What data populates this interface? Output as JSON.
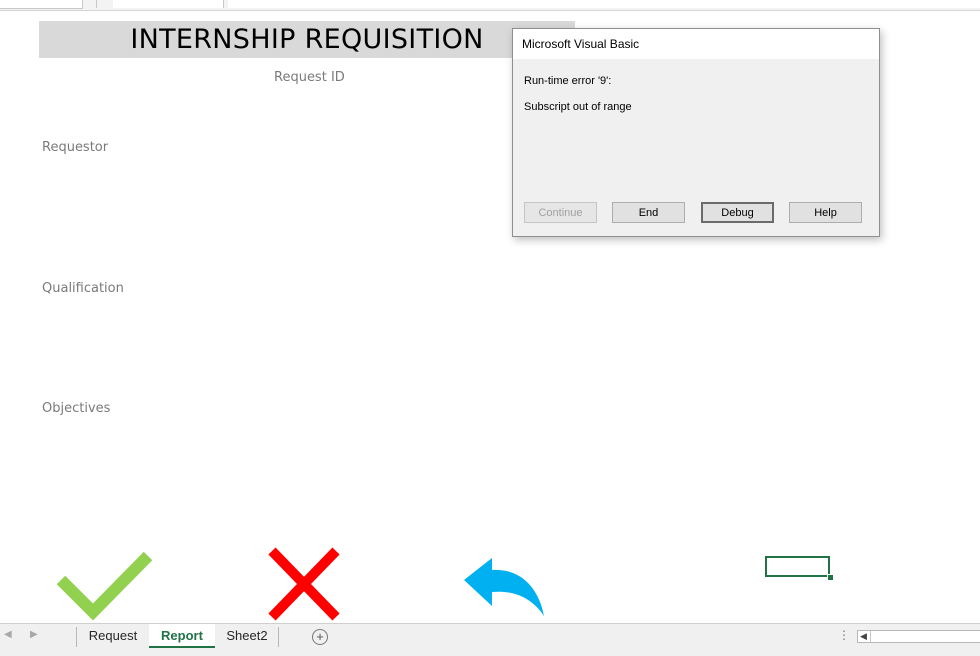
{
  "sheet": {
    "title": "INTERNSHIP REQUISITION",
    "request_id_label": "Request ID",
    "requestor_label": "Requestor",
    "qualification_label": "Qualification",
    "objectives_label": "Objectives"
  },
  "dialog": {
    "title": "Microsoft Visual Basic",
    "error_line": "Run-time error '9':",
    "message": "Subscript out of range",
    "buttons": {
      "continue": "Continue",
      "end": "End",
      "debug": "Debug",
      "help": "Help"
    }
  },
  "shapes": {
    "approve": {
      "icon": "checkmark-icon",
      "color": "#92d050"
    },
    "reject": {
      "icon": "red-x-icon",
      "color": "#ff0000"
    },
    "back": {
      "icon": "curved-back-arrow-icon",
      "color": "#00b0f0"
    }
  },
  "tabs": [
    {
      "label": "Request",
      "active": false
    },
    {
      "label": "Report",
      "active": true
    },
    {
      "label": "Sheet2",
      "active": false
    }
  ],
  "colors": {
    "excel_green": "#217346",
    "title_band": "#d9d9d9"
  }
}
